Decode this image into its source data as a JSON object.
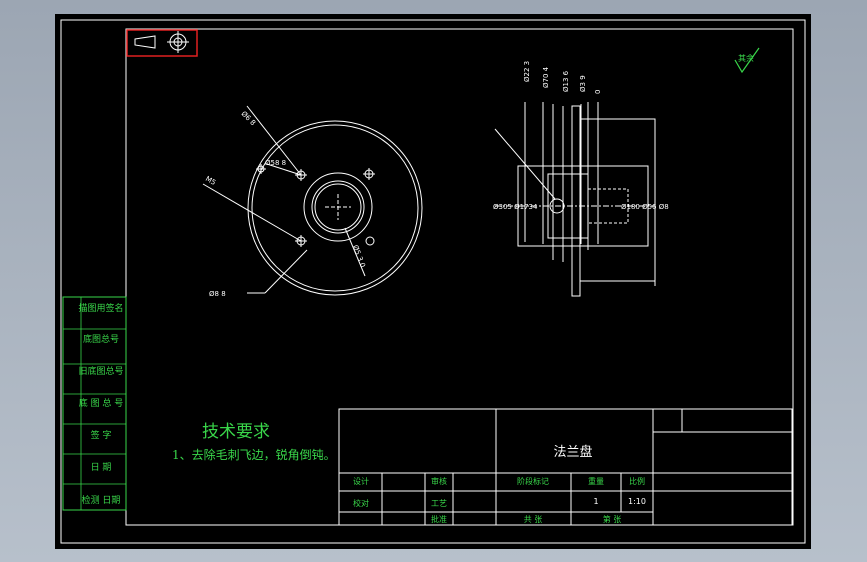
{
  "colors": {
    "background": "#000000",
    "line": "#ffffff",
    "title_block": "#39d64a",
    "highlight": "#e02020",
    "desktop": "#a9b3c0"
  },
  "left_strip": {
    "cells": [
      "描图用签名",
      "底图总号",
      "旧底图总号",
      "底 图 总 号",
      "签  字",
      "日  期",
      "检测  日期"
    ]
  },
  "tech_req": {
    "title": "技术要求",
    "line1": "1、去除毛刺飞边，锐角倒钝。"
  },
  "title_block": {
    "part_name": "法兰盘",
    "design": "设计",
    "check": "校对",
    "std_review": "审核",
    "approve": "工艺",
    "approved_by": "批准",
    "stage_mark": "阶段标记",
    "weight": "重量",
    "ratio_label": "比例",
    "ratio": "1:10",
    "quantity": "1",
    "sheet_total": "共 张",
    "sheet_no": "第 张"
  },
  "front_view": {
    "labels": [
      "Ø6 8",
      "M5",
      "Ø8 8",
      "Ø58 8",
      "Ø5 3 0"
    ]
  },
  "side_view": {
    "labels": [
      "Ø305 Ø1734",
      "Ø180 Ø56 Ø8",
      "Ø22 3",
      "Ø70 4",
      "Ø13 6",
      "Ø3 9",
      "0"
    ]
  },
  "roughness": {
    "label": "其余"
  }
}
